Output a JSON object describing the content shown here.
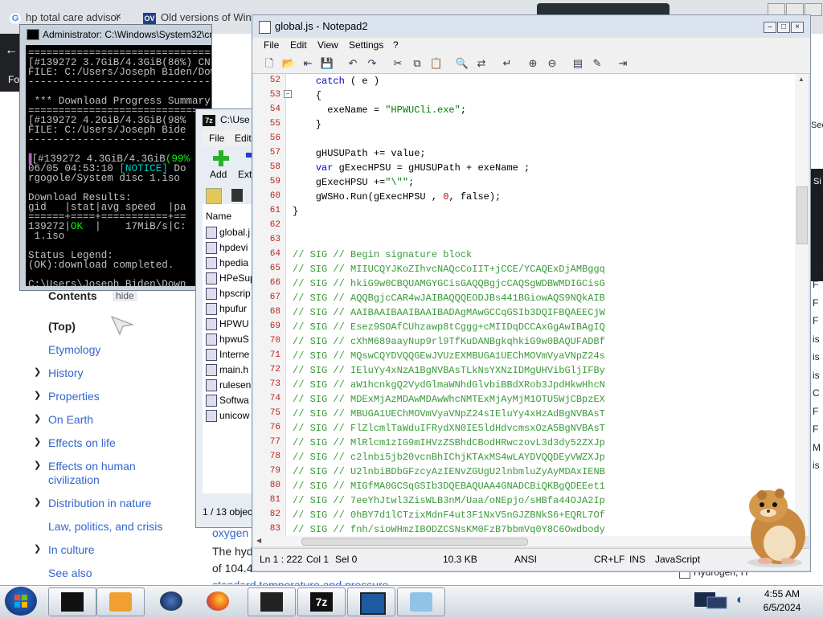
{
  "browser": {
    "tabs": [
      "hp total care advisor",
      "Old versions of Windows"
    ],
    "tab_close": "×",
    "partial_fo": "Fo",
    "partial_sec": "Sec",
    "partial_si": "Si"
  },
  "wiki": {
    "contents_label": "Contents",
    "hide_label": "hide",
    "toc": [
      {
        "label": "(Top)",
        "bold": true,
        "chev": false
      },
      {
        "label": "Etymology",
        "chev": false
      },
      {
        "label": "History",
        "chev": true
      },
      {
        "label": "Properties",
        "chev": true
      },
      {
        "label": "On Earth",
        "chev": true
      },
      {
        "label": "Effects on life",
        "chev": true
      },
      {
        "label": "Effects on human",
        "chev": true
      },
      {
        "label": "civilization",
        "chev": false
      },
      {
        "label": "Distribution in nature",
        "chev": true
      },
      {
        "label": "Law, politics, and crisis",
        "chev": false
      },
      {
        "label": "In culture",
        "chev": true
      },
      {
        "label": "See also",
        "chev": false
      }
    ],
    "body_link": "oxygen",
    "body_text1": "The hyd",
    "body_text2": "of 104.4",
    "body_link2": "standard temperature and pressure",
    "infobox_label": "Hydrogen, H"
  },
  "cmd": {
    "title": "Administrator: C:\\Windows\\System32\\cmd.exe",
    "lines": [
      "================================",
      "[#139272 3.7GiB/4.3GiB(86%) CN:16 D",
      "FILE: C:/Users/Joseph Biden/Downloa",
      "--------------------------------",
      "",
      " *** Download Progress Summary as o",
      "================================",
      "[#139272 4.2GiB/4.3GiB(98%",
      "FILE: C:/Users/Joseph Bide",
      "--------------------------",
      "",
      "[#139272 4.3GiB/4.3GiB(99%",
      "06/05 04:53:10 [NOTICE] Do",
      "rgogole/System disc 1.iso",
      "",
      "Download Results:",
      "gid   |stat|avg speed  |pa",
      "======+====+===========+==",
      "139272|OK  |    17MiB/s|C:",
      " 1.iso",
      "",
      "Status Legend:",
      "(OK):download completed.",
      "",
      "C:\\Users\\Joseph Biden\\Down"
    ]
  },
  "zip": {
    "title": "C:\\Use",
    "menu": [
      "File",
      "Edit"
    ],
    "add_label": "Add",
    "ext_label": "Ext",
    "col_name": "Name",
    "files": [
      "global.j",
      "hpdevi",
      "hpedia",
      "HPeSup",
      "hpscrip",
      "hpufur",
      "HPWU",
      "hpwuS",
      "Interne",
      "main.h",
      "rulesen",
      "Softwa",
      "unicow"
    ],
    "status": "1 / 13 objec"
  },
  "notepad": {
    "title": "global.js - Notepad2",
    "menu": [
      "File",
      "Edit",
      "View",
      "Settings",
      "?"
    ],
    "line_start": 52,
    "code": [
      [
        [
          "    ",
          ""
        ],
        [
          "catch",
          "kw"
        ],
        [
          " ( e )",
          ""
        ]
      ],
      [
        [
          "    {",
          ""
        ]
      ],
      [
        [
          "      exeName = ",
          ""
        ],
        [
          "\"HPWUCli.exe\"",
          "str"
        ],
        [
          ";",
          ""
        ]
      ],
      [
        [
          "    }",
          ""
        ]
      ],
      [
        [
          "",
          ""
        ]
      ],
      [
        [
          "    gHUSUPath += value;",
          ""
        ]
      ],
      [
        [
          "    ",
          ""
        ],
        [
          "var",
          "kw"
        ],
        [
          " gExecHPSU = gHUSUPath + exeName ;",
          ""
        ]
      ],
      [
        [
          "    gExecHPSU +=",
          ""
        ],
        [
          "\"\\\"\"",
          "str"
        ],
        [
          ";",
          ""
        ]
      ],
      [
        [
          "    gWSHo.Run(gExecHPSU , ",
          ""
        ],
        [
          "0",
          "num"
        ],
        [
          ", false);",
          ""
        ]
      ],
      [
        [
          "}",
          ""
        ]
      ],
      [
        [
          "",
          ""
        ]
      ],
      [
        [
          "",
          ""
        ]
      ],
      [
        [
          "// SIG // Begin signature block",
          "cm"
        ]
      ],
      [
        [
          "// SIG // MIIUCQYJKoZIhvcNAQcCoIIT+jCCE/YCAQExDjAMBggq",
          "cm"
        ]
      ],
      [
        [
          "// SIG // hkiG9w0CBQUAMGYGCisGAQQBgjcCAQSgWDBWMDIGCisG",
          "cm"
        ]
      ],
      [
        [
          "// SIG // AQQBgjcCAR4wJAIBAQQQEODJBs441BGiowAQS9NQkAIB",
          "cm"
        ]
      ],
      [
        [
          "// SIG // AAIBAAIBAAIBAAIBADAgMAwGCCqGSIb3DQIFBQAEECjW",
          "cm"
        ]
      ],
      [
        [
          "// SIG // Esez9SOAfCUhzawp8tCggg+cMIIDqDCCAxGgAwIBAgIQ",
          "cm"
        ]
      ],
      [
        [
          "// SIG // cXhM689aayNup9rl9TfKuDANBgkqhkiG9w0BAQUFADBf",
          "cm"
        ]
      ],
      [
        [
          "// SIG // MQswCQYDVQQGEwJVUzEXMBUGA1UEChMOVmVyaVNpZ24s",
          "cm"
        ]
      ],
      [
        [
          "// SIG // IEluYy4xNzA1BgNVBAsTLkNsYXNzIDMgUHVibGljIFBy",
          "cm"
        ]
      ],
      [
        [
          "// SIG // aW1hcnkgQ2VydGlmaWNhdGlvbiBBdXRob3JpdHkwHhcN",
          "cm"
        ]
      ],
      [
        [
          "// SIG // MDExMjAzMDAwMDAwWhcNMTExMjAyMjM1OTU5WjCBpzEX",
          "cm"
        ]
      ],
      [
        [
          "// SIG // MBUGA1UEChMOVmVyaVNpZ24sIEluYy4xHzAdBgNVBAsT",
          "cm"
        ]
      ],
      [
        [
          "// SIG // FlZlcmlTaWduIFRydXN0IE5ldHdvcmsxOzA5BgNVBAsT",
          "cm"
        ]
      ],
      [
        [
          "// SIG // MlRlcm1zIG9mIHVzZSBhdCBodHRwczovL3d3dy52ZXJp",
          "cm"
        ]
      ],
      [
        [
          "// SIG // c2lnbi5jb20vcnBhIChjKTAxMS4wLAYDVQQDEyVWZXJp",
          "cm"
        ]
      ],
      [
        [
          "// SIG // U2lnbiBDbGFzcyAzIENvZGUgU2lnbmluZyAyMDAxIENB",
          "cm"
        ]
      ],
      [
        [
          "// SIG // MIGfMA0GCSqGSIb3DQEBAQUAA4GNADCBiQKBgQDEEet1",
          "cm"
        ]
      ],
      [
        [
          "// SIG // 7eeYhJtwl3ZisWLB3nM/Uaa/oNEpjo/sHBfa44OJA2Ip",
          "cm"
        ]
      ],
      [
        [
          "// SIG // 0hBY7d1lCTzixMdnF4ut3F1NxV5nGJZBNkS6+EQRL7Of",
          "cm"
        ]
      ],
      [
        [
          "// SIG // fnh/sioWHmzIBODZCSNsKM0FzB7bbmVq0Y8C6Owdbody",
          "cm"
        ]
      ]
    ],
    "status": {
      "pos": "Ln 1 : 222",
      "col": "Col 1",
      "sel": "Sel 0",
      "size": "10.3 KB",
      "encoding": "ANSI",
      "eol": "CR+LF",
      "mode": "INS",
      "lang": "JavaScript"
    }
  },
  "right_letters": [
    "F",
    "A",
    "F",
    "F",
    "F",
    "is",
    "is",
    "is",
    "C",
    "F",
    "F",
    "M",
    "is"
  ],
  "taskbar": {
    "time": "4:55 AM",
    "date": "6/5/2024"
  }
}
